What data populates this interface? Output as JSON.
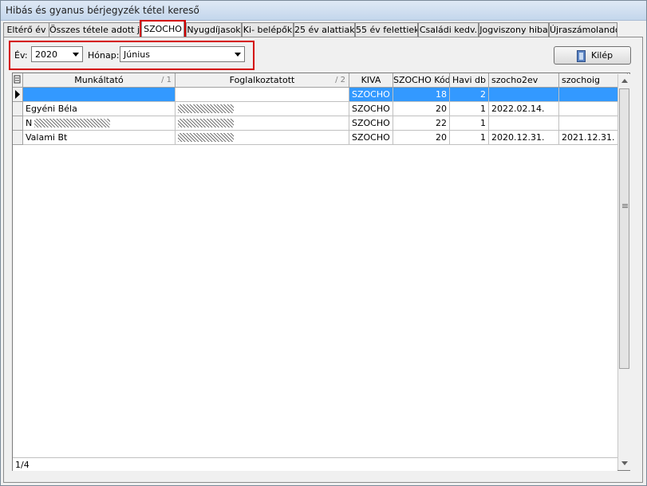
{
  "window": {
    "title": "Hibás és gyanus bérjegyzék tétel kereső"
  },
  "tabs": [
    {
      "label": "Eltérő év"
    },
    {
      "label": "Összes tétele adott jc"
    },
    {
      "label": "SZOCHO"
    },
    {
      "label": "Nyugdíjasok"
    },
    {
      "label": "Ki- belépők"
    },
    {
      "label": "25 év alattiak"
    },
    {
      "label": "55 év felettiek"
    },
    {
      "label": "Családi kedv."
    },
    {
      "label": "Jogviszony hiba"
    },
    {
      "label": "Újraszámolandó"
    }
  ],
  "active_tab": "SZOCHO",
  "filters": {
    "year_label": "Év:",
    "year_value": "2020",
    "month_label": "Hónap:",
    "month_value": "Június"
  },
  "exit_button": {
    "label": "Kilép",
    "icon": "door-exit-icon"
  },
  "grid": {
    "columns": [
      {
        "label": "Munkáltató",
        "sort": "/ 1"
      },
      {
        "label": "Foglalkoztatott",
        "sort": "/ 2"
      },
      {
        "label": "KIVA",
        "sort": ""
      },
      {
        "label": "SZOCHO Kód",
        "sort": ""
      },
      {
        "label": "Havi db",
        "sort": ""
      },
      {
        "label": "szocho2ev",
        "sort": ""
      },
      {
        "label": "szochoig",
        "sort": ""
      }
    ],
    "rows": [
      {
        "munkaltato": "",
        "foglalkoztatott": "",
        "kiva": "SZOCHO",
        "kod": "18",
        "havi": "2",
        "szocho2ev": "",
        "szochoig": ""
      },
      {
        "munkaltato": "Egyéni Béla",
        "foglalkoztatott": "",
        "kiva": "SZOCHO",
        "kod": "20",
        "havi": "1",
        "szocho2ev": "2022.02.14.",
        "szochoig": ""
      },
      {
        "munkaltato": "N",
        "foglalkoztatott": "",
        "kiva": "SZOCHO",
        "kod": "22",
        "havi": "1",
        "szocho2ev": "",
        "szochoig": ""
      },
      {
        "munkaltato": "Valami Bt",
        "foglalkoztatott": "",
        "kiva": "SZOCHO",
        "kod": "20",
        "havi": "1",
        "szocho2ev": "2020.12.31.",
        "szochoig": "2021.12.31."
      }
    ],
    "status": "1/4"
  },
  "colors": {
    "selection": "#3399ff",
    "highlight_box": "#d40000"
  }
}
